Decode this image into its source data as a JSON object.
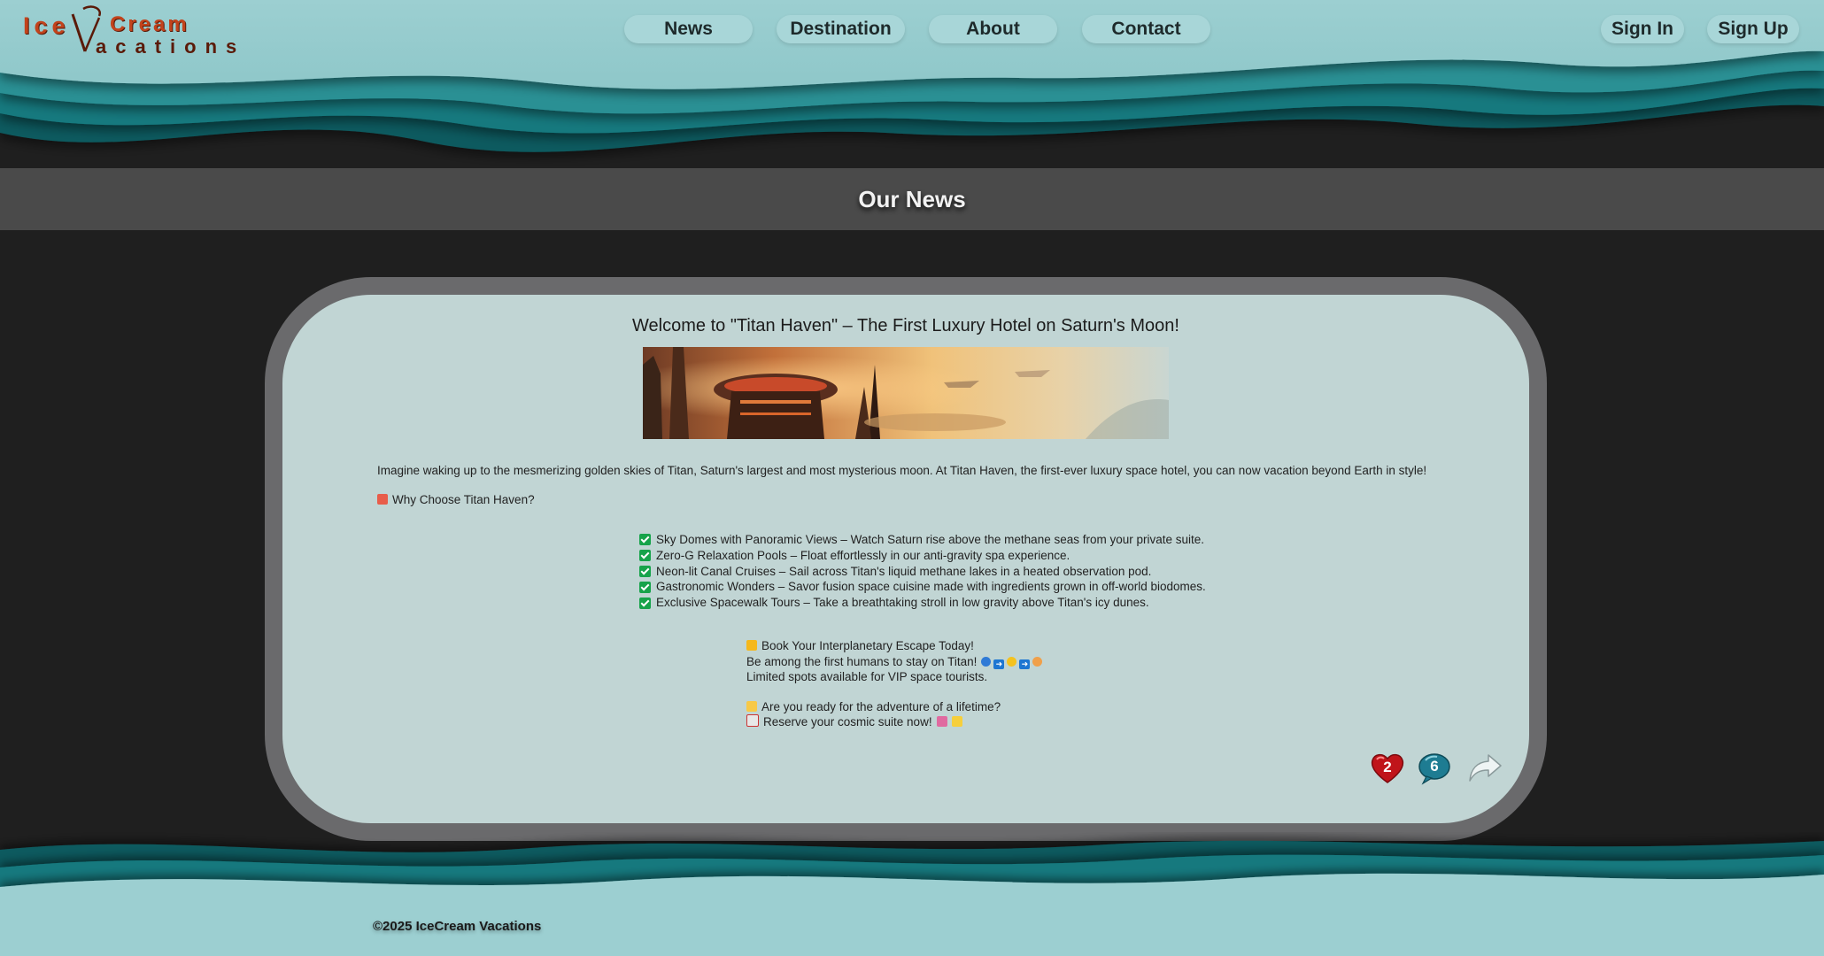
{
  "brand": {
    "logo_line1": "Ice",
    "logo_line1b": "Cream",
    "logo_line2": "acations"
  },
  "nav": {
    "items": [
      "News",
      "Destination",
      "About",
      "Contact"
    ],
    "sign_in": "Sign In",
    "sign_up": "Sign Up"
  },
  "page": {
    "title": "Our News"
  },
  "post": {
    "title": "Welcome to \"Titan Haven\" – The First Luxury Hotel on Saturn's Moon!",
    "intro": "Imagine waking up to the mesmerizing golden skies of Titan, Saturn's largest and most mysterious moon. At Titan Haven, the first-ever luxury space hotel, you can now vacation beyond Earth in style!",
    "why": "Why Choose Titan Haven?",
    "features": [
      "Sky Domes with Panoramic Views – Watch Saturn rise above the methane seas from your private suite.",
      "Zero-G Relaxation Pools – Float effortlessly in our anti-gravity spa experience.",
      "Neon-lit Canal Cruises – Sail across Titan's liquid methane lakes in a heated observation pod.",
      "Gastronomic Wonders – Savor fusion space cuisine made with ingredients grown in off-world biodomes.",
      "Exclusive Spacewalk Tours – Take a breathtaking stroll in low gravity above Titan's icy dunes."
    ],
    "cta_book": "Book Your Interplanetary Escape Today!",
    "cta_first": "Be among the first humans to stay on Titan!",
    "cta_limited": "Limited spots available for VIP space tourists.",
    "cta_ready": "Are you ready for the adventure of a lifetime?",
    "cta_reserve": "Reserve your cosmic suite now!",
    "likes": "2",
    "comments": "6"
  },
  "footer": {
    "copyright": "©2025 IceCream Vacations"
  },
  "icons": {
    "hotel": "hotel-icon",
    "check": "check-icon",
    "book": "sparkle-icon",
    "ready": "star-icon",
    "reserve": "calendar-icon",
    "like": "heart-icon",
    "comment": "comment-icon",
    "share": "share-icon"
  },
  "colors": {
    "teal_light": "#9ccfd1",
    "teal_dark": "#157e83",
    "card_bg": "#c1d5d4",
    "card_frame": "#6a6a6c",
    "brand": "#c2431c",
    "heart": "#c0141a",
    "comment": "#1e7c92",
    "check": "#16a34a"
  }
}
